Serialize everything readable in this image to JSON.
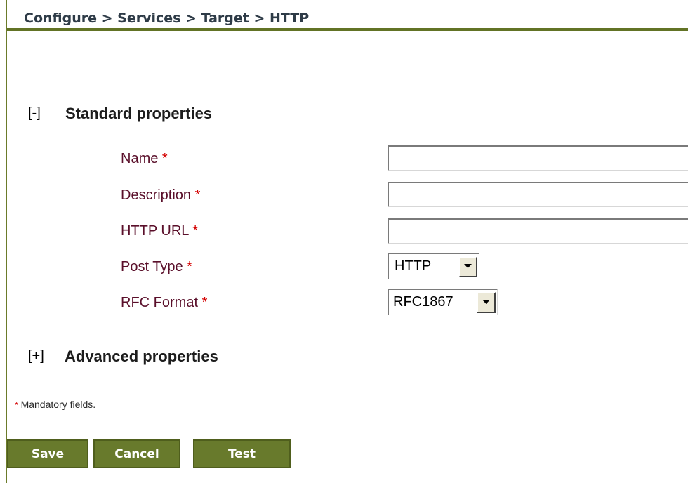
{
  "header": {
    "breadcrumb": "Configure > Services > Target > HTTP"
  },
  "sections": {
    "standard": {
      "toggle": "[-]",
      "title": "Standard properties"
    },
    "advanced": {
      "toggle": "[+]",
      "title": "Advanced properties"
    }
  },
  "fields": {
    "name": {
      "label": "Name",
      "required": "*",
      "value": ""
    },
    "description": {
      "label": "Description",
      "required": "*",
      "value": ""
    },
    "http_url": {
      "label": "HTTP URL",
      "required": "*",
      "value": ""
    },
    "post_type": {
      "label": "Post Type",
      "required": "*",
      "selected": "HTTP"
    },
    "rfc_format": {
      "label": "RFC Format",
      "required": "*",
      "selected": "RFC1867"
    }
  },
  "footer": {
    "mandatory_marker": "*",
    "mandatory_text": "Mandatory fields."
  },
  "buttons": {
    "save": "Save",
    "cancel": "Cancel",
    "test": "Test"
  },
  "colors": {
    "accent": "#627325",
    "button_bg": "#687a2c",
    "required": "#d40000",
    "label": "#5a0f2a"
  }
}
